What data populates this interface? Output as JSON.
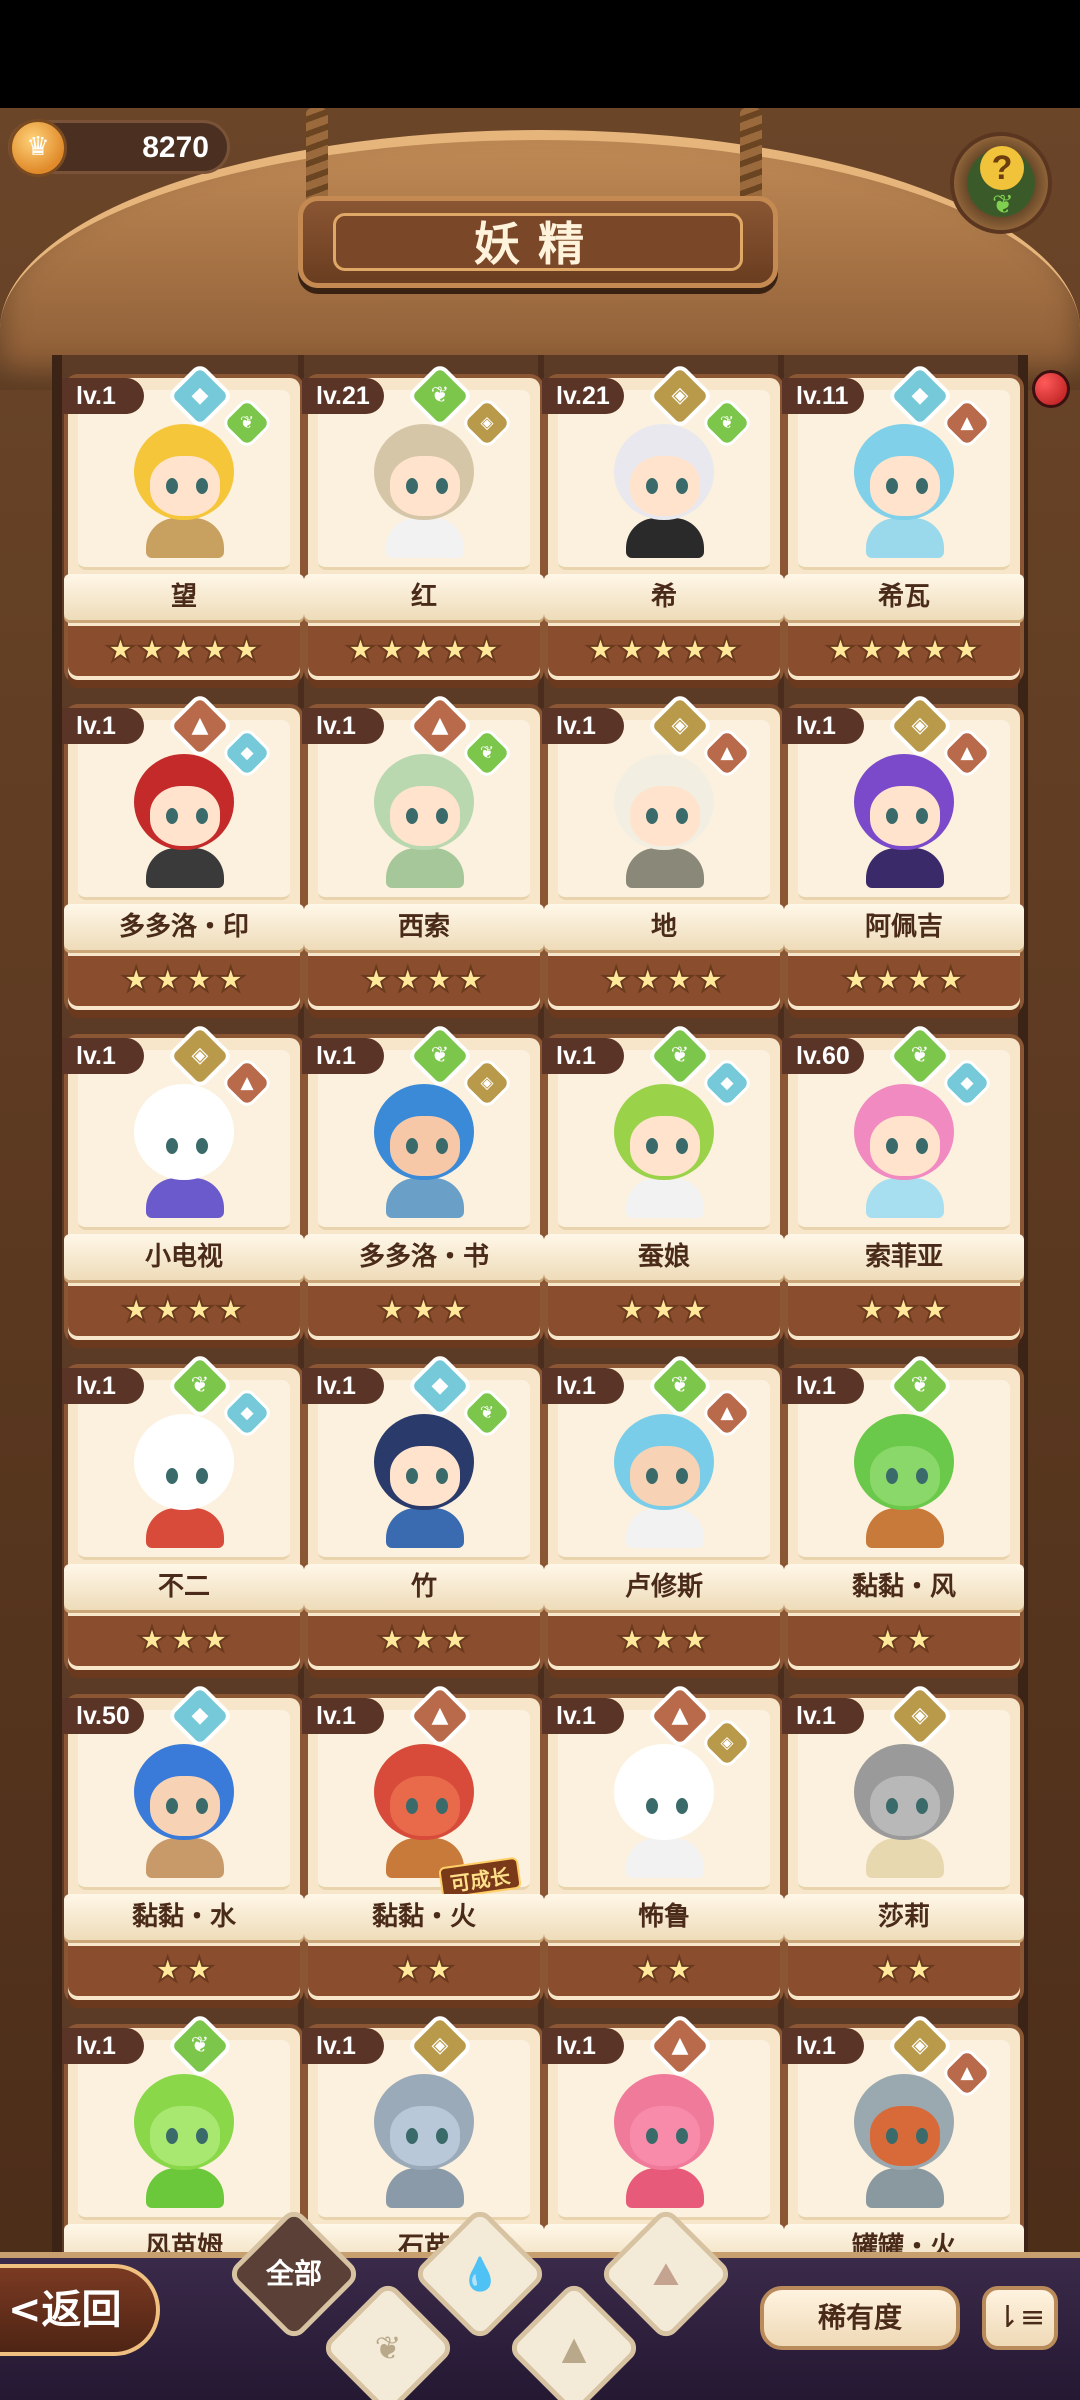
{
  "header": {
    "coins": "8270",
    "title": "妖精",
    "help_symbol": "?"
  },
  "colors": {
    "green": "#7cc64c",
    "blue": "#76c9d8",
    "gold": "#b99a4a",
    "red": "#b86a4a"
  },
  "cards": [
    {
      "level": "lv.1",
      "name": "望",
      "stars": 5,
      "elements": [
        "blue-icon",
        "green-icon"
      ],
      "hair": "#f6c63a",
      "skin": "#ffe3cc",
      "body": "#c8a060"
    },
    {
      "level": "lv.21",
      "name": "红",
      "stars": 5,
      "elements": [
        "green-icon",
        "gold-icon"
      ],
      "hair": "#d6c6a8",
      "skin": "#ffe3cc",
      "body": "#f2f2f2"
    },
    {
      "level": "lv.21",
      "name": "希",
      "stars": 5,
      "elements": [
        "gold-icon",
        "green-icon"
      ],
      "hair": "#e8e8ee",
      "skin": "#ffe3cc",
      "body": "#2a2a2a"
    },
    {
      "level": "lv.11",
      "name": "希瓦",
      "stars": 5,
      "elements": [
        "blue-icon",
        "red-icon"
      ],
      "hair": "#7fd0e8",
      "skin": "#ffe3cc",
      "body": "#9ad8ec"
    },
    {
      "level": "lv.1",
      "name": "多多洛・印",
      "stars": 4,
      "elements": [
        "red-icon",
        "blue-icon"
      ],
      "hair": "#c42a2a",
      "skin": "#ffe3cc",
      "body": "#3a3a3a"
    },
    {
      "level": "lv.1",
      "name": "西索",
      "stars": 4,
      "elements": [
        "red-icon",
        "green-icon"
      ],
      "hair": "#b9d8b0",
      "skin": "#ffe3cc",
      "body": "#a6c79a"
    },
    {
      "level": "lv.1",
      "name": "地",
      "stars": 4,
      "elements": [
        "gold-icon",
        "red-icon"
      ],
      "hair": "#f2efe2",
      "skin": "#ffe3cc",
      "body": "#8a8878"
    },
    {
      "level": "lv.1",
      "name": "阿佩吉",
      "stars": 4,
      "elements": [
        "gold-icon",
        "red-icon"
      ],
      "hair": "#7a4acb",
      "skin": "#ffe3cc",
      "body": "#3a2a6a"
    },
    {
      "level": "lv.1",
      "name": "小电视",
      "stars": 4,
      "elements": [
        "gold-icon",
        "red-icon"
      ],
      "hair": "#ffffff",
      "skin": "#ffffff",
      "body": "#6a5acb"
    },
    {
      "level": "lv.1",
      "name": "多多洛・书",
      "stars": 3,
      "elements": [
        "green-icon",
        "gold-icon"
      ],
      "hair": "#3a8ad8",
      "skin": "#f7c8a8",
      "body": "#6aa0c8"
    },
    {
      "level": "lv.1",
      "name": "蚕娘",
      "stars": 3,
      "elements": [
        "green-icon",
        "blue-icon"
      ],
      "hair": "#9ad24a",
      "skin": "#ffe3cc",
      "body": "#f2f2f2"
    },
    {
      "level": "lv.60",
      "name": "索菲亚",
      "stars": 3,
      "elements": [
        "green-icon",
        "blue-icon"
      ],
      "hair": "#f08ac0",
      "skin": "#ffe3cc",
      "body": "#a8dff0"
    },
    {
      "level": "lv.1",
      "name": "不二",
      "stars": 3,
      "elements": [
        "green-icon",
        "blue-icon"
      ],
      "hair": "#ffffff",
      "skin": "#ffffff",
      "body": "#d84a3a"
    },
    {
      "level": "lv.1",
      "name": "竹",
      "stars": 3,
      "elements": [
        "blue-icon",
        "green-icon"
      ],
      "hair": "#2a3a6a",
      "skin": "#ffe3cc",
      "body": "#3a6ab0"
    },
    {
      "level": "lv.1",
      "name": "卢修斯",
      "stars": 3,
      "elements": [
        "green-icon",
        "red-icon"
      ],
      "hair": "#7acde8",
      "skin": "#f7d2b4",
      "body": "#f2f2f2"
    },
    {
      "level": "lv.1",
      "name": "黏黏・风",
      "stars": 2,
      "elements": [
        "green-icon"
      ],
      "hair": "#6ac84a",
      "skin": "#8ad86a",
      "body": "#c87a3a"
    },
    {
      "level": "lv.50",
      "name": "黏黏・水",
      "stars": 2,
      "elements": [
        "blue-icon"
      ],
      "hair": "#3a7ad8",
      "skin": "#f7d2b4",
      "body": "#c89a6a"
    },
    {
      "level": "lv.1",
      "name": "黏黏・火",
      "stars": 2,
      "elements": [
        "red-icon"
      ],
      "hair": "#d84a3a",
      "skin": "#e86a4a",
      "body": "#c87a3a",
      "badge": "可成长"
    },
    {
      "level": "lv.1",
      "name": "怖鲁",
      "stars": 2,
      "elements": [
        "red-icon",
        "gold-icon"
      ],
      "hair": "#ffffff",
      "skin": "#ffffff",
      "body": "#f2f2f2"
    },
    {
      "level": "lv.1",
      "name": "莎莉",
      "stars": 2,
      "elements": [
        "gold-icon"
      ],
      "hair": "#9a9a9a",
      "skin": "#b8b8b8",
      "body": "#e8d8b0"
    },
    {
      "level": "lv.1",
      "name": "风苗姆",
      "stars": 0,
      "elements": [
        "green-icon"
      ],
      "hair": "#8ad84a",
      "skin": "#a8e870",
      "body": "#6ac83a"
    },
    {
      "level": "lv.1",
      "name": "石苗",
      "stars": 0,
      "elements": [
        "gold-icon"
      ],
      "hair": "#9aaab8",
      "skin": "#b8c8d8",
      "body": "#8a9aa8"
    },
    {
      "level": "lv.1",
      "name": "",
      "stars": 0,
      "elements": [
        "red-icon"
      ],
      "hair": "#f07a9a",
      "skin": "#f88aaa",
      "body": "#e85a7a"
    },
    {
      "level": "lv.1",
      "name": "罐罐・火",
      "stars": 0,
      "elements": [
        "gold-icon",
        "red-icon"
      ],
      "hair": "#9aa8b0",
      "skin": "#d86a3a",
      "body": "#8a98a0"
    }
  ],
  "bottom": {
    "back_label": "<返回",
    "all_label": "全部",
    "rarity_label": "稀有度",
    "sort_symbol": "⇂≡"
  }
}
